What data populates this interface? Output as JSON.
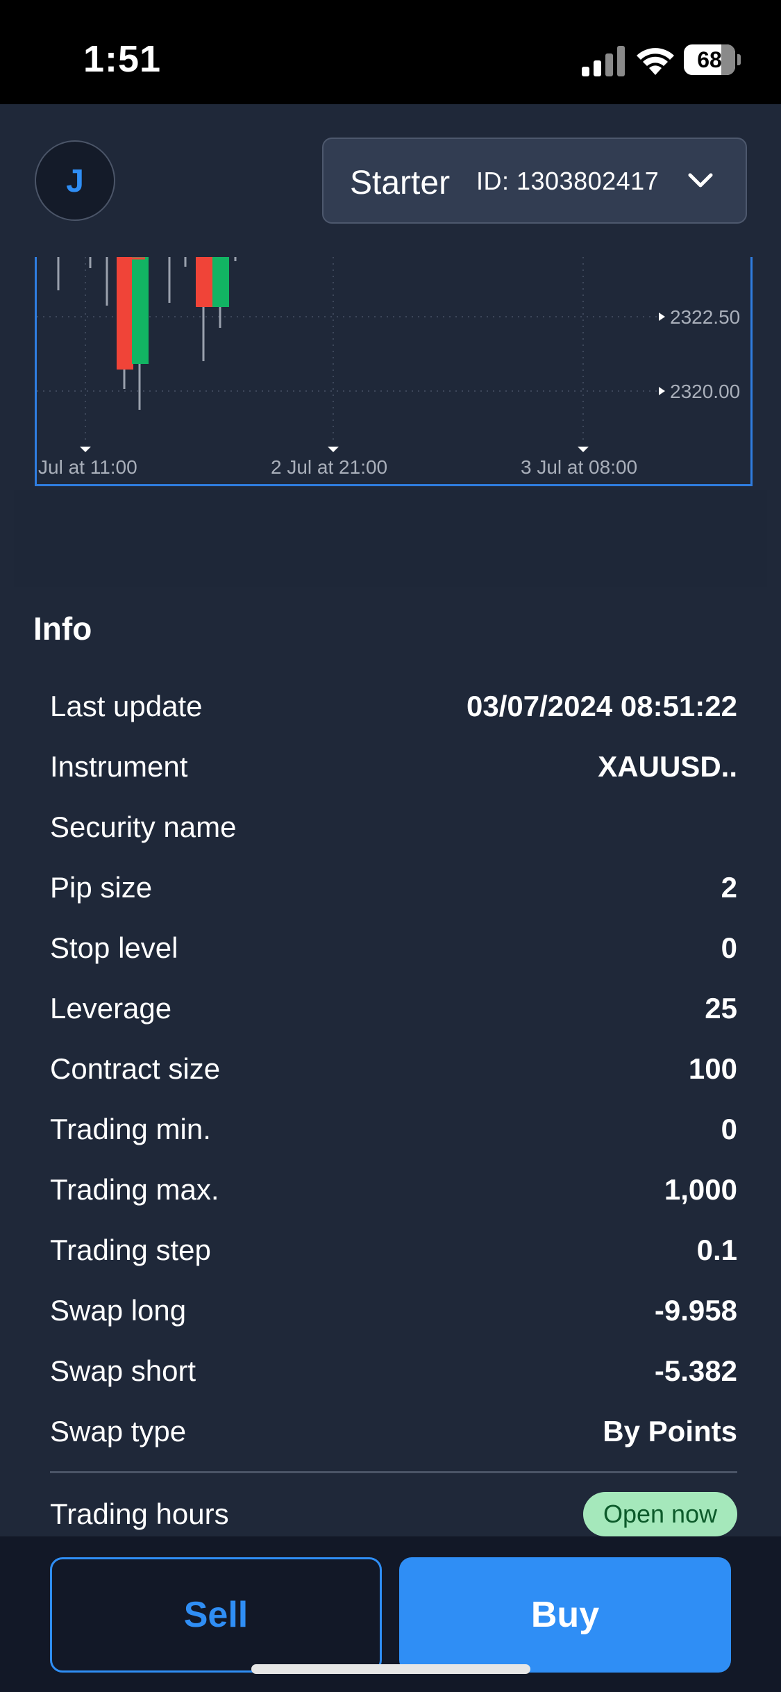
{
  "status_bar": {
    "time": "1:51",
    "battery": "68"
  },
  "header": {
    "avatar_initial": "J",
    "account_name": "Starter",
    "account_id": "ID: 1303802417"
  },
  "chart_data": {
    "type": "candlestick",
    "y_tick_labels": [
      "2322.50",
      "2320.00"
    ],
    "x_tick_labels": [
      "Jul at 11:00",
      "2 Jul at 21:00",
      "3 Jul at 08:00"
    ],
    "colors": {
      "up": "#12b463",
      "down": "#f04438",
      "wick": "#9aa1ad"
    }
  },
  "info": {
    "title": "Info",
    "rows": [
      {
        "label": "Last update",
        "value": "03/07/2024 08:51:22"
      },
      {
        "label": "Instrument",
        "value": "XAUUSD.."
      },
      {
        "label": "Security name",
        "value": ""
      },
      {
        "label": "Pip size",
        "value": "2"
      },
      {
        "label": "Stop level",
        "value": "0"
      },
      {
        "label": "Leverage",
        "value": "25"
      },
      {
        "label": "Contract size",
        "value": "100"
      },
      {
        "label": "Trading min.",
        "value": "0"
      },
      {
        "label": "Trading max.",
        "value": "1,000"
      },
      {
        "label": "Trading step",
        "value": "0.1"
      },
      {
        "label": "Swap long",
        "value": "-9.958"
      },
      {
        "label": "Swap short",
        "value": "-5.382"
      },
      {
        "label": "Swap type",
        "value": "By Points"
      }
    ],
    "trading_hours_label": "Trading hours",
    "open_badge": "Open now"
  },
  "actions": {
    "sell_label": "Sell",
    "buy_label": "Buy"
  }
}
